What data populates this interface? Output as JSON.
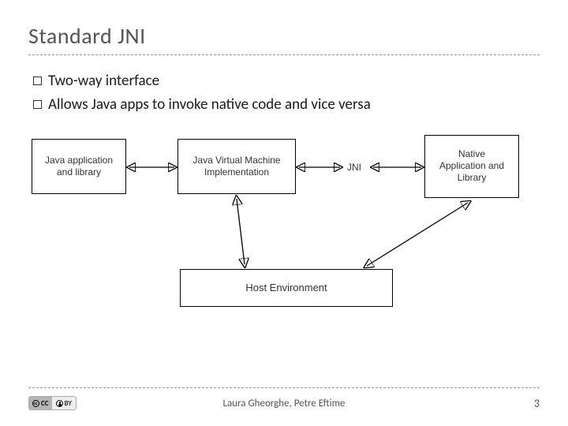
{
  "title": "Standard JNI",
  "bullets": [
    "Two-way interface",
    "Allows Java apps to invoke native code and vice versa"
  ],
  "diagram": {
    "box_java_app": "Java application\nand library",
    "box_jvm": "Java Virtual Machine\nImplementation",
    "jni_label": "JNI",
    "box_native": "Native\nApplication and\nLibrary",
    "box_host": "Host Environment"
  },
  "footer": {
    "license_left": "CC",
    "license_right": "BY",
    "authors": "Laura Gheorghe, Petre Eftime",
    "page": "3"
  }
}
